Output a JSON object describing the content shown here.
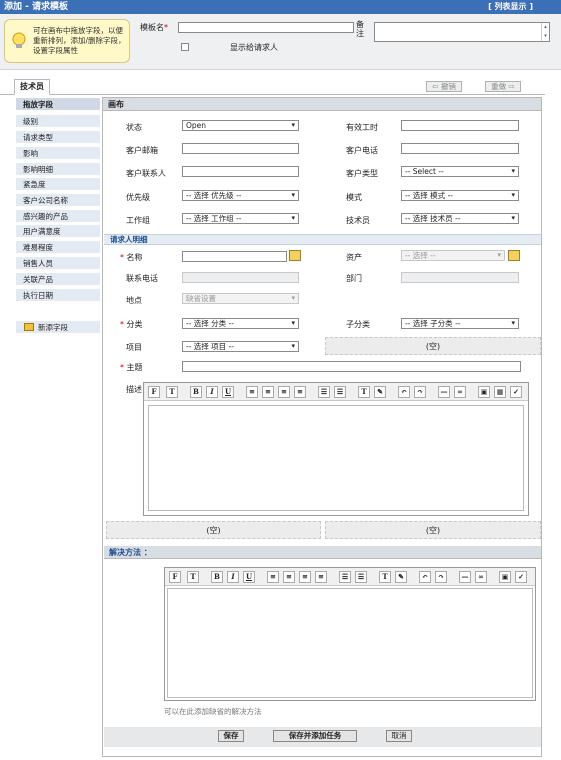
{
  "header": {
    "title": "添加 - 请求模板",
    "list_view": "[ 列表显示 ]"
  },
  "tip": {
    "text": "可在画布中拖放字段，以便重新排列，添加/删除字段，设置字段属性"
  },
  "template": {
    "name_label": "模板名",
    "note_label": "备注",
    "show_requester_label": "显示给请求人"
  },
  "tabs": {
    "tech": "技术员",
    "prev": "撤销",
    "next": "重做"
  },
  "sidebar": {
    "header": "拖放字段",
    "items": [
      "级别",
      "请求类型",
      "影响",
      "影响明细",
      "紧急度",
      "客户公司名称",
      "感兴趣的产品",
      "用户满意度",
      "难易程度",
      "销售人员",
      "关联产品",
      "执行日期"
    ],
    "new_field": "新添字段"
  },
  "canvas": {
    "header": "画布",
    "fields": {
      "status": "状态",
      "status_val": "Open",
      "work_time": "有效工时",
      "cust_email": "客户邮箱",
      "cust_phone": "客户电话",
      "cust_contact": "客户联系人",
      "cust_type": "客户类型",
      "cust_type_val": "-- Select --",
      "priority": "优先级",
      "priority_val": "-- 选择  优先级  --",
      "mode": "模式",
      "mode_val": "-- 选择  模式  --",
      "group": "工作组",
      "group_val": "-- 选择  工作组  --",
      "tech": "技术员",
      "tech_val": "-- 选择  技术员  --"
    },
    "requester": {
      "header": "请求人明细",
      "name": "名称",
      "asset": "资产",
      "asset_val": "-- 选择  --",
      "phone": "联系电话",
      "dept": "部门",
      "location": "地点",
      "location_val": "缺省设置"
    },
    "cat": {
      "category": "分类",
      "category_val": "-- 选择  分类  --",
      "subcategory": "子分类",
      "subcategory_val": "-- 选择  子分类  --",
      "item": "项目",
      "item_val": "-- 选择  项目  --",
      "empty": "(空)"
    },
    "subject": "主题",
    "desc": "描述",
    "empty1": "(空)",
    "empty2": "(空)",
    "resolution": {
      "header": "解决方法 ：",
      "hint": "可以在此添加缺省的解决方法"
    }
  },
  "footer": {
    "save": "保存",
    "save_add": "保存并添加任务",
    "cancel": "取消"
  },
  "rte_buttons": [
    "F",
    "T",
    "B",
    "I",
    "U",
    "align-left",
    "align-center",
    "align-right",
    "justify",
    "ordered-list",
    "unordered-list",
    "text-color",
    "highlight",
    "undo",
    "redo",
    "hr",
    "link",
    "image",
    "spellcheck"
  ]
}
